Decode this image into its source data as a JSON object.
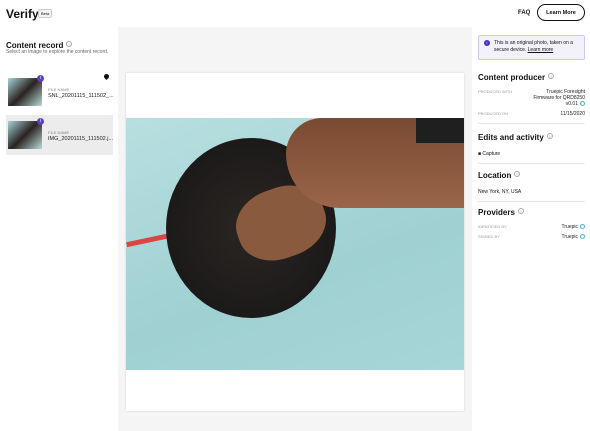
{
  "header": {
    "app_title": "Verify",
    "beta_label": "Beta",
    "faq_label": "FAQ",
    "learn_more_label": "Learn More"
  },
  "sidebar": {
    "title": "Content record",
    "description": "Select an image to explore the content record.",
    "items": [
      {
        "label": "FILE NAME",
        "file_name": "SNL_20201115_111502_...",
        "has_location": true
      },
      {
        "label": "FILE NAME",
        "file_name": "IMG_20201115_111502.j...",
        "selected": true
      }
    ]
  },
  "notice": {
    "text": "This is an original photo, taken on a secure device.",
    "link": "Learn more"
  },
  "content_producer": {
    "title": "Content producer",
    "produced_with_label": "PRODUCED WITH",
    "produced_with": "Truepic Foresight Firmware for QRD8250 v0.01",
    "produced_on_label": "PRODUCED ON",
    "produced_on": "11/15/2020"
  },
  "edits": {
    "title": "Edits and activity",
    "item": "Capture"
  },
  "location": {
    "title": "Location",
    "value": "New York, NY, USA"
  },
  "providers": {
    "title": "Providers",
    "identified_by_label": "IDENTIFIED BY",
    "identified_by": "Truepic",
    "signed_by_label": "SIGNED BY",
    "signed_by": "Truepic"
  },
  "colors": {
    "accent": "#5b3fc4",
    "verified": "#4ab0d0"
  }
}
